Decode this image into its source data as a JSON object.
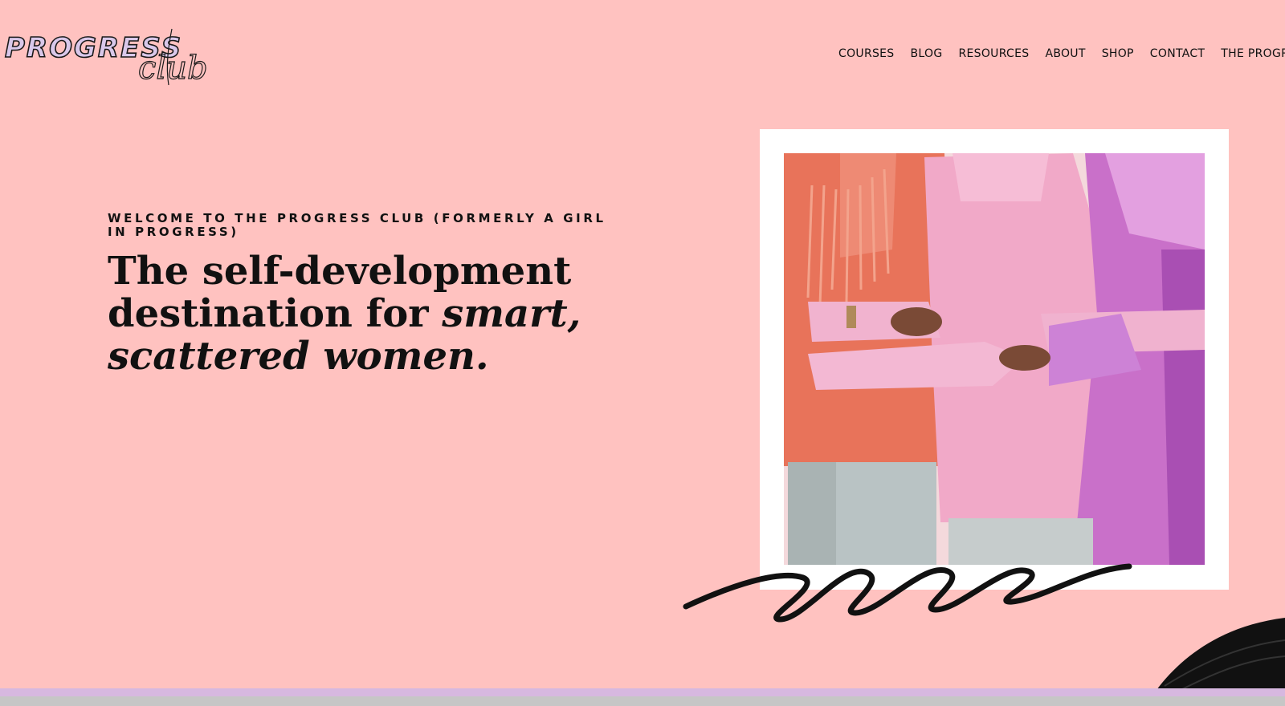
{
  "logo": {
    "word": "PROGRESS",
    "script": "club"
  },
  "nav": {
    "items": [
      {
        "label": "COURSES"
      },
      {
        "label": "BLOG"
      },
      {
        "label": "RESOURCES"
      },
      {
        "label": "ABOUT"
      },
      {
        "label": "SHOP"
      },
      {
        "label": "CONTACT"
      },
      {
        "label": "THE PROGRA"
      }
    ]
  },
  "hero": {
    "eyebrow": "WELCOME TO THE PROGRESS CLUB (FORMERLY A GIRL IN PROGRESS)",
    "headline_plain": "The self-development destination for ",
    "headline_italic_1": "smart,",
    "headline_italic_2": "scattered women."
  },
  "colors": {
    "background": "#ffc2c0",
    "text": "#111111",
    "logo_fill": "#d9c8ea",
    "bottom_bar": "#d7b8e0"
  }
}
